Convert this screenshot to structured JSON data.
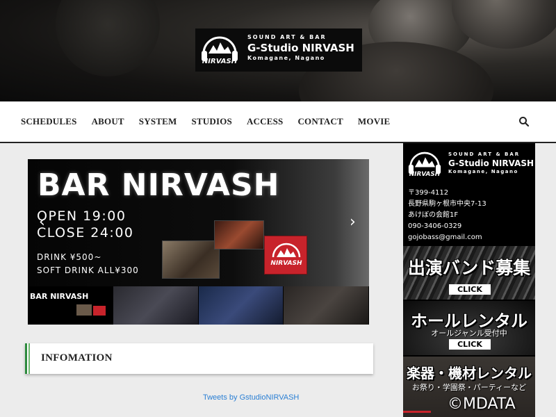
{
  "logo": {
    "subtitle": "SOUND ART & BAR",
    "name": "G-Studio NIRVASH",
    "location": "Komagane, Nagano",
    "mark": "NIRVASH"
  },
  "nav": {
    "items": [
      "SCHEDULES",
      "ABOUT",
      "SYSTEM",
      "STUDIOS",
      "ACCESS",
      "CONTACT",
      "MOVIE"
    ],
    "search_icon": "search-icon"
  },
  "slider": {
    "title": "BAR NIRVASH",
    "open": "OPEN  19:00",
    "close": "CLOSE  24:00",
    "drink": "DRINK    ¥500~",
    "soft_drink": "SOFT DRINK   ALL¥300",
    "prev_arrow": "‹",
    "next_arrow": "›",
    "thumb_title": "BAR NIRVASH"
  },
  "info": {
    "title": "INFOMATION"
  },
  "tweets": {
    "link": "Tweets by GstudioNIRVASH"
  },
  "sidebar": {
    "address": [
      "〒399-4112",
      "長野県駒ヶ根市中央7-13",
      "あけぼの会館1F",
      "090-3406-0329",
      "gojobass@gmail.com"
    ],
    "banners": [
      {
        "title": "出演バンド募集",
        "click": "CLICK"
      },
      {
        "title": "ホールレンタル",
        "sub": "オールジャンル受付中",
        "click": "CLICK"
      },
      {
        "title": "楽器・機材レンタル",
        "sub": "お祭り・学園祭・パーティーなど"
      }
    ]
  },
  "watermark": "©MDATA",
  "colors": {
    "accent_green": "#2e8b3e",
    "link_blue": "#2a7fd4"
  }
}
